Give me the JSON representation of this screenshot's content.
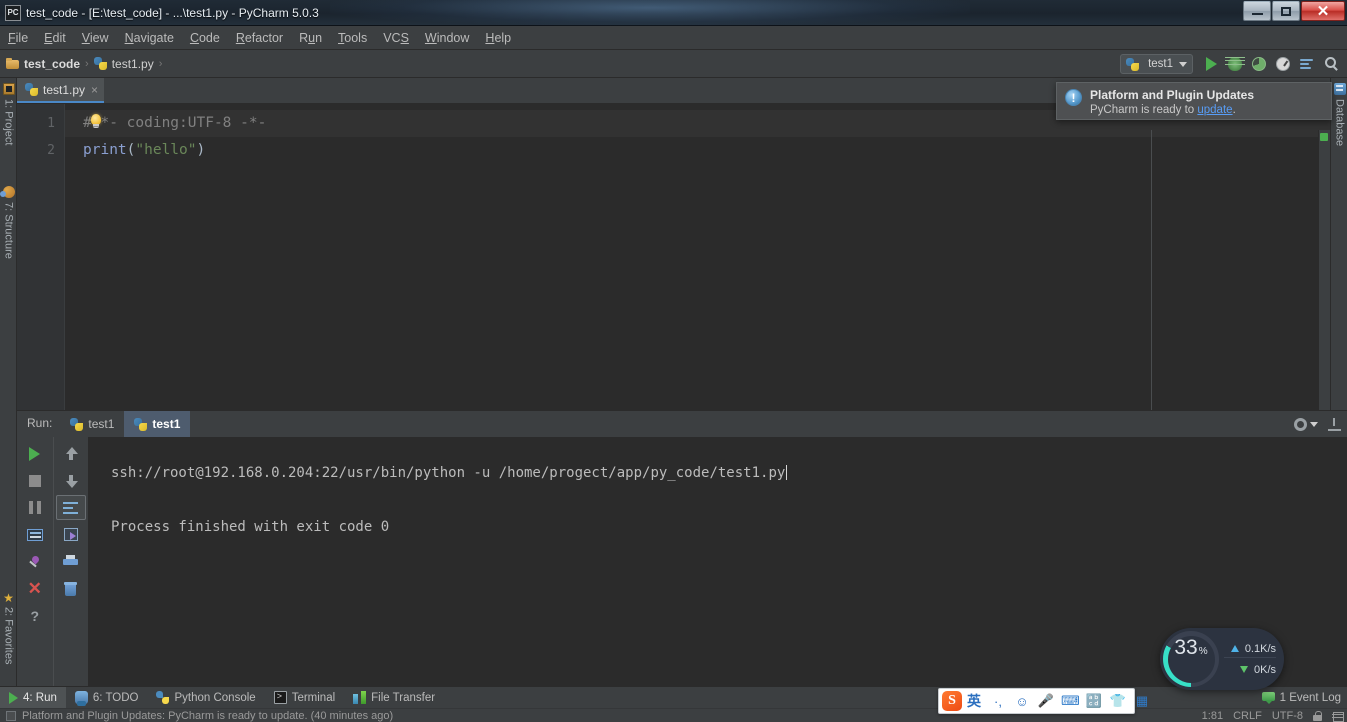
{
  "window": {
    "title": "test_code - [E:\\test_code] - ...\\test1.py - PyCharm 5.0.3",
    "app_icon": "PC",
    "minimize_label": "Minimize",
    "maximize_label": "Maximize",
    "close_label": "✕"
  },
  "menu": [
    {
      "label": "File",
      "mnemonic": "F"
    },
    {
      "label": "Edit",
      "mnemonic": "E"
    },
    {
      "label": "View",
      "mnemonic": "V"
    },
    {
      "label": "Navigate",
      "mnemonic": "N"
    },
    {
      "label": "Code",
      "mnemonic": "C"
    },
    {
      "label": "Refactor",
      "mnemonic": "R"
    },
    {
      "label": "Run",
      "mnemonic": "u"
    },
    {
      "label": "Tools",
      "mnemonic": "T"
    },
    {
      "label": "VCS",
      "mnemonic": "S"
    },
    {
      "label": "Window",
      "mnemonic": "W"
    },
    {
      "label": "Help",
      "mnemonic": "H"
    }
  ],
  "breadcrumb": {
    "project": "test_code",
    "file": "test1.py",
    "separator": "›"
  },
  "toolbar": {
    "run_config": "test1",
    "icons": [
      "run-icon",
      "debug-icon",
      "coverage-icon",
      "profile-icon",
      "todo-list-icon",
      "search-everywhere-icon"
    ]
  },
  "left_strip": [
    {
      "label": "1: Project",
      "icon": "project-icon"
    },
    {
      "label": "7: Structure",
      "icon": "structure-icon"
    },
    {
      "label": "2: Favorites",
      "icon": "favorites-star-icon"
    }
  ],
  "right_strip": [
    {
      "label": "Database",
      "icon": "database-icon"
    }
  ],
  "editor": {
    "tab_label": "test1.py",
    "tab_close": "×",
    "lines": [
      {
        "number": "1",
        "segments": [
          {
            "text": "#-*- coding:UTF-8 -*-",
            "type": "comment"
          }
        ]
      },
      {
        "number": "2",
        "segments": [
          {
            "text": "print",
            "type": "fn"
          },
          {
            "text": "(",
            "type": "paren"
          },
          {
            "text": "\"hello\"",
            "type": "str"
          },
          {
            "text": ")",
            "type": "paren"
          }
        ]
      }
    ]
  },
  "notification": {
    "icon": "!",
    "title": "Platform and Plugin Updates",
    "body_prefix": "PyCharm is ready to ",
    "link": "update",
    "body_suffix": "."
  },
  "run_panel": {
    "label": "Run:",
    "tabs": [
      {
        "label": "test1",
        "active": false
      },
      {
        "label": "test1",
        "active": true
      }
    ],
    "left_tools": [
      "rerun-icon",
      "stop-icon",
      "pause-icon",
      "show-console-icon",
      "pin-tab-icon",
      "close-icon",
      "help-icon"
    ],
    "right_tools": [
      "up-arrow-icon",
      "down-arrow-icon",
      "soft-wrap-icon",
      "scroll-to-end-icon",
      "print-icon",
      "clear-all-icon"
    ],
    "header_tools": [
      "settings-gear-icon",
      "hide-icon"
    ],
    "console_lines": [
      "ssh://root@192.168.0.204:22/usr/bin/python -u /home/progect/app/py_code/test1.py",
      "Process finished with exit code 0"
    ]
  },
  "network_widget": {
    "percent": "33",
    "percent_symbol": "%",
    "upload": "0.1K/s",
    "download": "0K/s"
  },
  "bottom_bar": {
    "items": [
      {
        "label": "4: Run",
        "icon": "run-play-icon",
        "active": true
      },
      {
        "label": "6: TODO",
        "icon": "todo-icon",
        "active": false
      },
      {
        "label": "Python Console",
        "icon": "python-console-icon",
        "active": false
      },
      {
        "label": "Terminal",
        "icon": "terminal-icon",
        "active": false
      },
      {
        "label": "File Transfer",
        "icon": "file-transfer-icon",
        "active": false
      }
    ],
    "event_log": "1 Event Log"
  },
  "ime": {
    "logo": "S",
    "items": [
      "英",
      "·,",
      "☺",
      "🎤",
      "⌨",
      "🔡",
      "👕",
      "▦"
    ]
  },
  "status_bar": {
    "message": "Platform and Plugin Updates: PyCharm is ready to update. (40 minutes ago)",
    "caret": "1:81",
    "line_ending": "CRLF",
    "encoding": "UTF-8",
    "lock_icon": "lock-icon",
    "memory_icon": "memory-icon"
  }
}
